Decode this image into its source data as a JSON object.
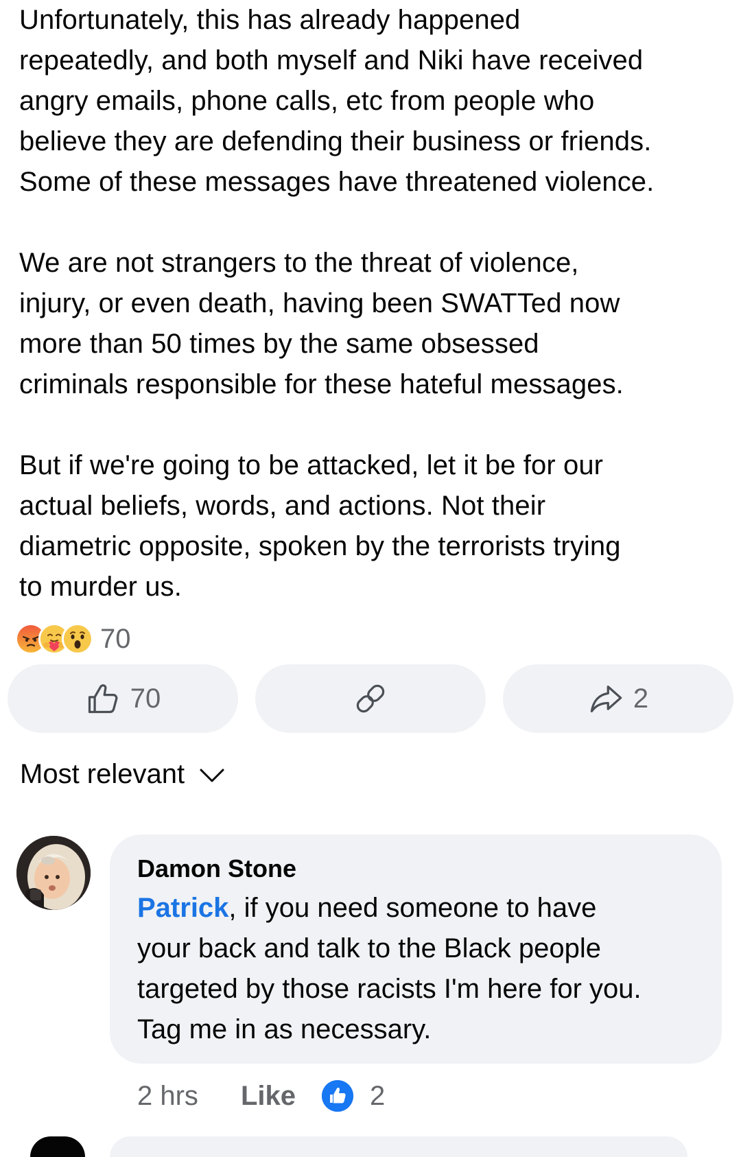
{
  "post": {
    "paragraphs": [
      "Unfortunately, this has already happened\nrepeatedly, and both myself and Niki have received\nangry emails, phone calls, etc from people who\nbelieve they are defending their business or friends.\nSome of these messages have threatened violence.",
      "We are not strangers to the threat of violence,\ninjury, or even death, having been SWATTed now\nmore than 50 times by the same obsessed\ncriminals responsible for these hateful messages.",
      "But if we're going to be attacked, let it be for our\nactual beliefs, words, and actions. Not their\ndiametric opposite, spoken by the terrorists trying\nto murder us."
    ]
  },
  "reactions": {
    "icons": [
      "angry-icon",
      "care-icon",
      "wow-icon"
    ],
    "count": "70"
  },
  "actions": {
    "like_count": "70",
    "share_count": "2"
  },
  "sort": {
    "label": "Most relevant"
  },
  "comment": {
    "author": "Damon Stone",
    "mention": "Patrick",
    "text": ", if you need someone to have\nyour back and talk to the Black people\ntargeted by those racists I'm here for you.\nTag me in as necessary.",
    "time": "2 hrs",
    "like_label": "Like",
    "like_count": "2"
  },
  "colors": {
    "link_blue": "#1b74e4",
    "like_blue": "#1877f2",
    "bubble_bg": "#f0f2f5",
    "secondary_text": "#65676b"
  }
}
